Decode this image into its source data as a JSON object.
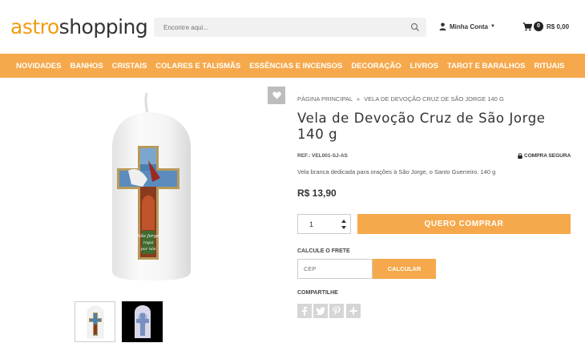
{
  "header": {
    "logo_part1": "astro",
    "logo_part2": "shopping",
    "search_placeholder": "Encontre aqui...",
    "account_label": "Minha Conta",
    "cart_count": "0",
    "cart_total": "R$ 0,00"
  },
  "nav": {
    "items": [
      "NOVIDADES",
      "BANHOS",
      "CRISTAIS",
      "COLARES E TALISMÃS",
      "ESSÊNCIAS E INCENSOS",
      "DECORAÇÃO",
      "LIVROS",
      "TAROT E BARALHOS",
      "RITUAIS"
    ]
  },
  "breadcrumb": {
    "home": "PÁGINA PRINCIPAL",
    "separator": "»",
    "current": "VELA DE DEVOÇÃO CRUZ DE SÃO JORGE 140 G"
  },
  "product": {
    "title": "Vela de Devoção Cruz de São Jorge 140 g",
    "ref": "REF.: VEL001-SJ-AS",
    "secure_label": "COMPRA SEGURA",
    "description": "Vela branca dedicada para orações à São Jorge, o Santo Guerreiro. 140 g",
    "price": "R$ 13,90",
    "quantity": "1",
    "buy_label": "QUERO COMPRAR",
    "image_caption": "São Jorge rogai por nós"
  },
  "shipping": {
    "label": "CALCULE O FRETE",
    "cep_placeholder": "CEP",
    "calc_label": "CALCULAR"
  },
  "share": {
    "label": "COMPARTILHE",
    "icons": [
      "facebook-icon",
      "twitter-icon",
      "pinterest-icon",
      "plus-icon"
    ]
  },
  "colors": {
    "accent": "#f6a94c",
    "logo_orange": "#f39c12",
    "text_dark": "#333333"
  }
}
